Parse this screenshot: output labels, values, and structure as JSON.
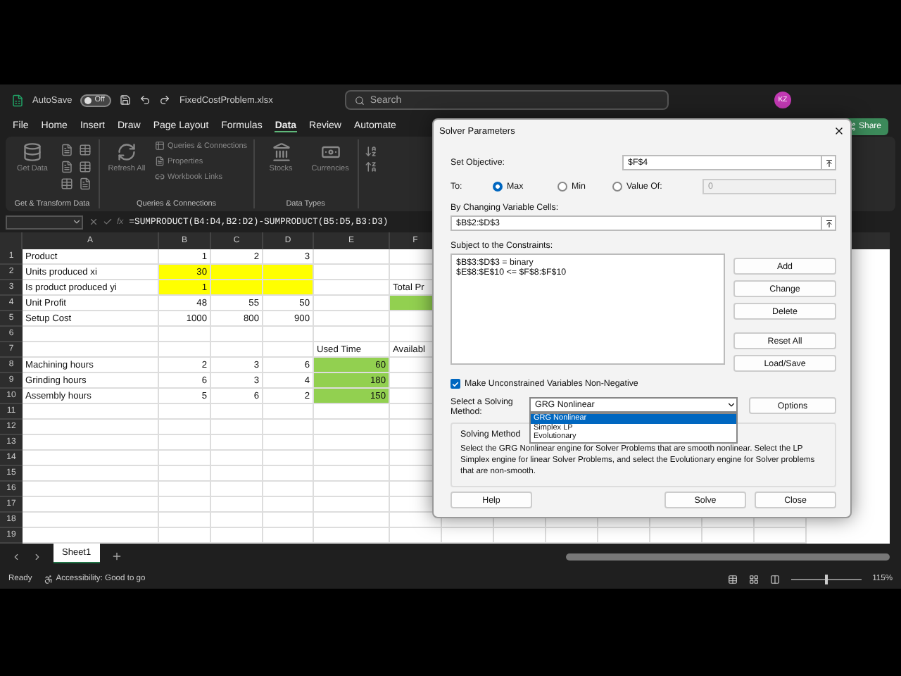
{
  "title_bar": {
    "autosave_label": "AutoSave",
    "autosave_state": "Off",
    "autosave_on": false,
    "filename": "FixedCostProblem.xlsx",
    "search_placeholder": "Search",
    "avatar": "KZ"
  },
  "ribbon_tabs": [
    {
      "label": "File",
      "selected": false
    },
    {
      "label": "Home",
      "selected": false
    },
    {
      "label": "Insert",
      "selected": false
    },
    {
      "label": "Draw",
      "selected": false
    },
    {
      "label": "Page Layout",
      "selected": false
    },
    {
      "label": "Formulas",
      "selected": false
    },
    {
      "label": "Data",
      "selected": true
    },
    {
      "label": "Review",
      "selected": false
    },
    {
      "label": "Automate",
      "selected": false
    }
  ],
  "share_button": "Share",
  "ribbon_groups": [
    {
      "kind": "get",
      "title": "Get & Transform Data",
      "large": [
        "Get Data"
      ]
    },
    {
      "kind": "queries",
      "title": "Queries & Connections",
      "large": [
        "Refresh All"
      ],
      "small": [
        "Queries & Connections",
        "Properties",
        "Workbook Links"
      ]
    },
    {
      "kind": "types",
      "title": "Data Types",
      "large": [
        "Stocks",
        "Currencies"
      ]
    }
  ],
  "fx_label": "fx",
  "formula": "=SUMPRODUCT(B4:D4,B2:D2)-SUMPRODUCT(B5:D5,B3:D3)",
  "sheet": {
    "columns": [
      "A",
      "B",
      "C",
      "D",
      "E",
      "F"
    ],
    "rows": [
      {
        "n": "1",
        "cells": [
          {
            "text": "Product"
          },
          {
            "text": "1",
            "kind": "number"
          },
          {
            "text": "2",
            "kind": "number"
          },
          {
            "text": "3",
            "kind": "number"
          },
          null,
          null
        ]
      },
      {
        "n": "2",
        "cells": [
          {
            "text": "Units produced xi"
          },
          {
            "text": "30",
            "kind": "number",
            "color": "#ffff00"
          },
          {
            "color": "#ffff00"
          },
          {
            "color": "#ffff00"
          },
          null,
          null
        ]
      },
      {
        "n": "3",
        "cells": [
          {
            "text": "Is product produced yi"
          },
          {
            "text": "1",
            "kind": "number",
            "color": "#ffff00"
          },
          {
            "color": "#ffff00"
          },
          {
            "color": "#ffff00"
          },
          null,
          {
            "text": "Total Pr"
          }
        ]
      },
      {
        "n": "4",
        "cells": [
          {
            "text": "Unit Profit"
          },
          {
            "text": "48",
            "kind": "number"
          },
          {
            "text": "55",
            "kind": "number"
          },
          {
            "text": "50",
            "kind": "number"
          },
          null,
          {
            "color": "#92d050"
          }
        ]
      },
      {
        "n": "5",
        "cells": [
          {
            "text": "Setup Cost"
          },
          {
            "text": "1000",
            "kind": "number"
          },
          {
            "text": "800",
            "kind": "number"
          },
          {
            "text": "900",
            "kind": "number"
          },
          null,
          null
        ]
      },
      {
        "n": "6",
        "cells": [
          null,
          null,
          null,
          null,
          null,
          null
        ]
      },
      {
        "n": "7",
        "cells": [
          null,
          null,
          null,
          null,
          {
            "text": "Used Time"
          },
          {
            "text": "Availabl"
          }
        ]
      },
      {
        "n": "8",
        "cells": [
          {
            "text": "Machining hours"
          },
          {
            "text": "2",
            "kind": "number"
          },
          {
            "text": "3",
            "kind": "number"
          },
          {
            "text": "6",
            "kind": "number"
          },
          {
            "text": "60",
            "kind": "number",
            "color": "#92d050"
          },
          null
        ]
      },
      {
        "n": "9",
        "cells": [
          {
            "text": "Grinding hours"
          },
          {
            "text": "6",
            "kind": "number"
          },
          {
            "text": "3",
            "kind": "number"
          },
          {
            "text": "4",
            "kind": "number"
          },
          {
            "text": "180",
            "kind": "number",
            "color": "#92d050"
          },
          null
        ]
      },
      {
        "n": "10",
        "cells": [
          {
            "text": "Assembly hours"
          },
          {
            "text": "5",
            "kind": "number"
          },
          {
            "text": "6",
            "kind": "number"
          },
          {
            "text": "2",
            "kind": "number"
          },
          {
            "text": "150",
            "kind": "number",
            "color": "#92d050"
          },
          null
        ]
      },
      {
        "n": "11",
        "cells": []
      },
      {
        "n": "12",
        "cells": []
      },
      {
        "n": "13",
        "cells": []
      },
      {
        "n": "14",
        "cells": []
      },
      {
        "n": "15",
        "cells": []
      },
      {
        "n": "16",
        "cells": []
      },
      {
        "n": "17",
        "cells": []
      },
      {
        "n": "18",
        "cells": []
      },
      {
        "n": "19",
        "cells": []
      }
    ]
  },
  "sheets": [
    {
      "label": "Sheet1",
      "selected": true
    }
  ],
  "status_bar": {
    "mode": "Ready",
    "accessibility": "Accessibility: Good to go",
    "zoom": "115%",
    "zoom_slider": {
      "level": 0.5
    }
  },
  "solver": {
    "title": "Solver Parameters",
    "objective_label": "Set Objective:",
    "objective": "$F$4",
    "to_label": "To:",
    "targets": [
      {
        "label": "Max",
        "selected": true
      },
      {
        "label": "Min",
        "selected": false
      },
      {
        "label": "Value Of:",
        "selected": false
      }
    ],
    "value_of": "0",
    "changing_label": "By Changing Variable Cells:",
    "changing": "$B$2:$D$3",
    "constraints_label": "Subject to the Constraints:",
    "constraints": [
      "$B$3:$D$3 = binary",
      "$E$8:$E$10 <= $F$8:$F$10"
    ],
    "constraint_buttons": [
      "Add",
      "Change",
      "Delete",
      "Reset All",
      "Load/Save"
    ],
    "nonneg": {
      "label": "Make Unconstrained Variables Non-Negative",
      "checked": true
    },
    "method_label": "Select a Solving Method:",
    "method": "GRG Nonlinear",
    "method_options": [
      {
        "label": "GRG Nonlinear",
        "selected": true
      },
      {
        "label": "Simplex LP",
        "selected": false
      },
      {
        "label": "Evolutionary",
        "selected": false
      }
    ],
    "options_button": "Options",
    "group_title": "Solving Method",
    "description": "Select the GRG Nonlinear engine for Solver Problems that are smooth nonlinear. Select the LP Simplex engine for linear Solver Problems, and select the Evolutionary engine for Solver problems that are non-smooth.",
    "buttons": [
      "Help",
      "Solve",
      "Close"
    ]
  }
}
